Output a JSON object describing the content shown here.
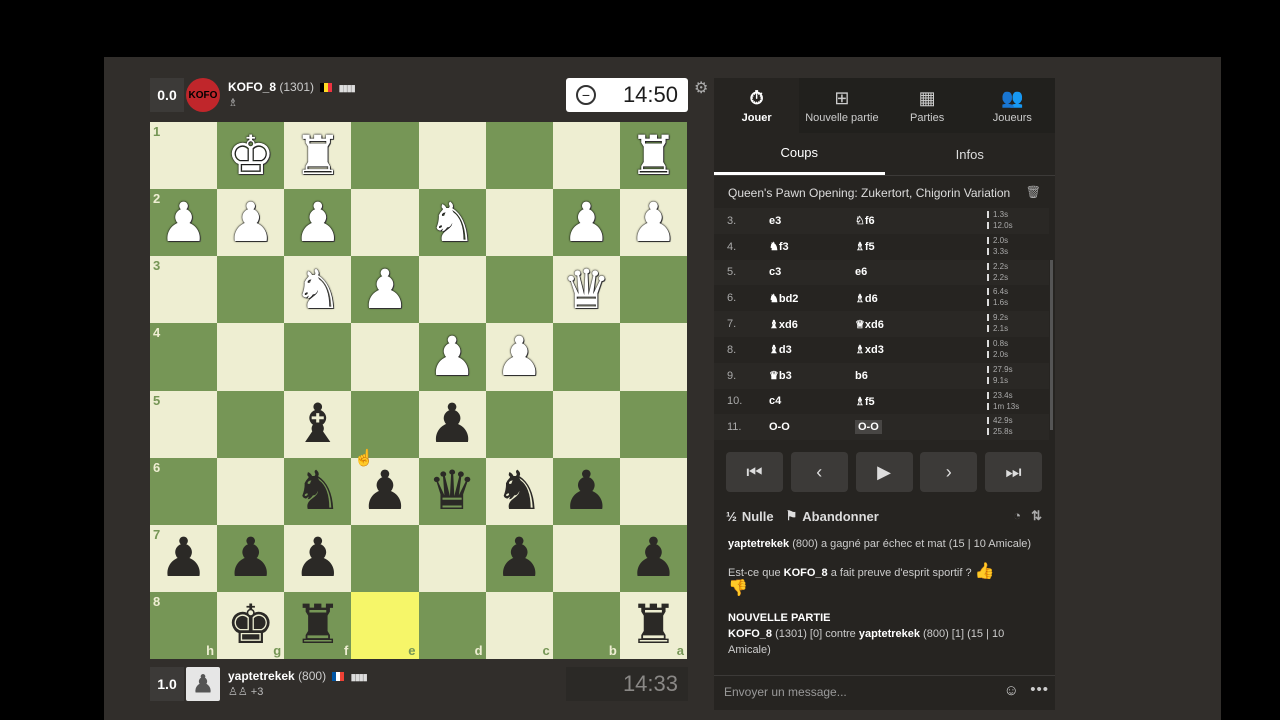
{
  "top_player": {
    "score": "0.0",
    "avatar_text": "KOFO",
    "name": "KOFO_8",
    "rating": "(1301)",
    "clock": "14:50"
  },
  "bottom_player": {
    "score": "1.0",
    "name": "yaptetrekek",
    "rating": "(800)",
    "captured_extra": "+3",
    "clock": "14:33"
  },
  "board": {
    "rank_labels": [
      "1",
      "2",
      "3",
      "4",
      "5",
      "6",
      "7",
      "8"
    ],
    "file_labels": [
      "h",
      "g",
      "f",
      "e",
      "d",
      "c",
      "b",
      "a"
    ],
    "highlight_squares": [
      "e8"
    ]
  },
  "tabs": [
    {
      "label": "Jouer",
      "icon": "stopwatch-icon"
    },
    {
      "label": "Nouvelle partie",
      "icon": "plus-icon"
    },
    {
      "label": "Parties",
      "icon": "board-icon"
    },
    {
      "label": "Joueurs",
      "icon": "users-icon"
    }
  ],
  "subtabs": [
    "Coups",
    "Infos"
  ],
  "opening": "Queen's Pawn Opening: Zukertort, Chigorin Variation",
  "moves": [
    {
      "num": "3.",
      "white": "e3",
      "black": "♘f6",
      "times": [
        "1.3s",
        "12.0s"
      ]
    },
    {
      "num": "4.",
      "white": "♞f3",
      "black": "♗f5",
      "times": [
        "2.0s",
        "3.3s"
      ]
    },
    {
      "num": "5.",
      "white": "c3",
      "black": "e6",
      "times": [
        "2.2s",
        "2.2s"
      ]
    },
    {
      "num": "6.",
      "white": "♞bd2",
      "black": "♗d6",
      "times": [
        "6.4s",
        "1.6s"
      ]
    },
    {
      "num": "7.",
      "white": "♝xd6",
      "black": "♕xd6",
      "times": [
        "9.2s",
        "2.1s"
      ]
    },
    {
      "num": "8.",
      "white": "♝d3",
      "black": "♗xd3",
      "times": [
        "0.8s",
        "2.0s"
      ]
    },
    {
      "num": "9.",
      "white": "♛b3",
      "black": "b6",
      "times": [
        "27.9s",
        "9.1s"
      ]
    },
    {
      "num": "10.",
      "white": "c4",
      "black": "♗f5",
      "times": [
        "23.4s",
        "1m 13s"
      ]
    },
    {
      "num": "11.",
      "white": "O-O",
      "black": "O-O",
      "times": [
        "42.9s",
        "25.8s"
      ]
    }
  ],
  "actions": {
    "draw": "Nulle",
    "draw_icon": "½",
    "resign": "Abandonner"
  },
  "chat": {
    "result_name": "yaptetrekek",
    "result_text": " (800) a gagné par échec et mat (15 | 10 Amicale)",
    "sport_prefix": "Est-ce que ",
    "sport_name": "KOFO_8",
    "sport_suffix": " a fait preuve d'esprit sportif ?",
    "new_game_title": "NOUVELLE PARTIE",
    "new_game_white": "KOFO_8",
    "new_game_mid": " (1301) [0] contre ",
    "new_game_black": "yaptetrekek",
    "new_game_end": " (800) [1] (15 | 10 Amicale)"
  },
  "message_placeholder": "Envoyer un message...",
  "colors": {
    "light_square": "#eeeed2",
    "dark_square": "#769656",
    "highlight": "#f6f669",
    "panel": "#262421"
  }
}
